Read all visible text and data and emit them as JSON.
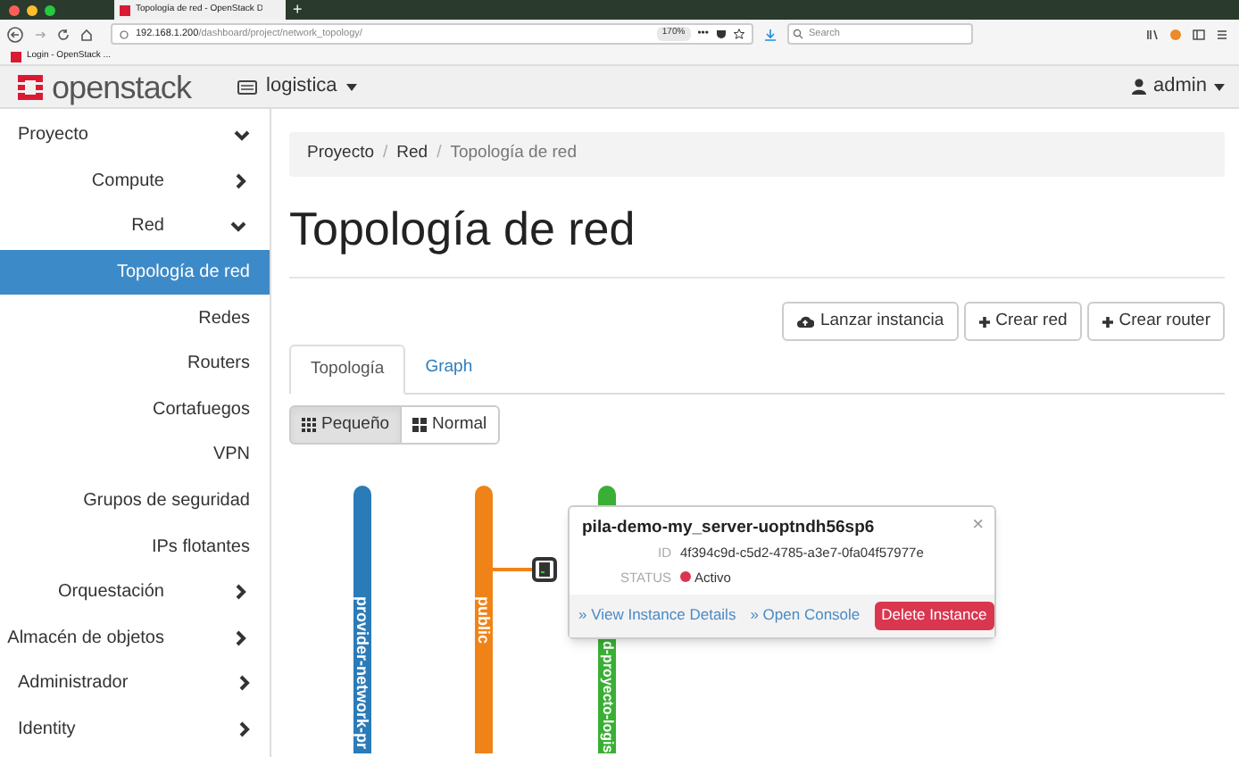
{
  "browser": {
    "tab_title": "Topología de red - OpenStack D",
    "new_tab": "+",
    "more": "•••",
    "url_host": "192.168.1.200",
    "url_path": "/dashboard/project/network_topology/",
    "zoom": "170%",
    "search": {
      "placeholder": "Search"
    },
    "bookmark": "Login - OpenStack ..."
  },
  "header": {
    "logo": "openstack",
    "project": "logistica",
    "user": "admin"
  },
  "sidebar": {
    "items": [
      {
        "label": "Proyecto",
        "expanded": true,
        "children": [
          {
            "label": "Compute",
            "expanded": false
          },
          {
            "label": "Red",
            "expanded": true,
            "children": [
              {
                "label": "Topología de red",
                "selected": true
              },
              {
                "label": "Redes",
                "selected": false
              },
              {
                "label": "Routers",
                "selected": false
              },
              {
                "label": "Cortafuegos",
                "selected": false
              },
              {
                "label": "VPN",
                "selected": false
              },
              {
                "label": "Grupos de seguridad",
                "selected": false
              },
              {
                "label": "IPs flotantes",
                "selected": false
              }
            ]
          },
          {
            "label": "Orquestación",
            "expanded": false
          },
          {
            "label": "Almacén de objetos",
            "expanded": false
          }
        ]
      },
      {
        "label": "Administrador",
        "expanded": false
      },
      {
        "label": "Identity",
        "expanded": false
      }
    ]
  },
  "breadcrumb": {
    "items": [
      "Proyecto",
      "Red",
      "Topología de red"
    ],
    "separator": "/"
  },
  "title": "Topología de red",
  "actions": [
    {
      "label": "Lanzar instancia",
      "kind": "cloud"
    },
    {
      "label": "Crear red",
      "kind": "plus"
    },
    {
      "label": "Crear router",
      "kind": "plus"
    }
  ],
  "tabs": [
    {
      "label": "Topología",
      "selected": true
    },
    {
      "label": "Graph",
      "selected": false
    }
  ],
  "view_toggle": [
    {
      "label": "Pequeño",
      "kind": "grid",
      "selected": true
    },
    {
      "label": "Normal",
      "kind": "tiles",
      "selected": false
    }
  ],
  "networks": [
    {
      "label": "provider-network-pr",
      "color": "#2b7bb9"
    },
    {
      "label": "public",
      "color": "#f08318"
    },
    {
      "label": "d-proyecto-logis",
      "color": "#3aaf35"
    }
  ],
  "popup": {
    "name": "pila-demo-my_server-uoptndh56sp6",
    "close": "×",
    "id_label": "ID",
    "id": "4f394c9d-c5d2-4785-a3e7-0fa04f57977e",
    "status_label": "STATUS",
    "status": "Activo",
    "links": [
      "» View Instance Details",
      "» Open Console"
    ],
    "delete": "Delete Instance"
  }
}
